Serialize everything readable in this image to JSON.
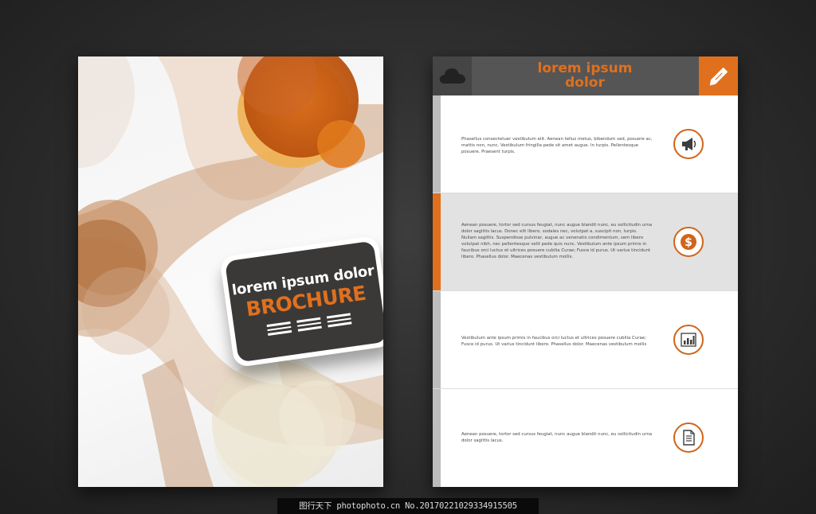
{
  "cover": {
    "badge_title": "lorem ipsum dolor",
    "badge_word": "BROCHURE"
  },
  "inner": {
    "header_title": "lorem ipsum dolor",
    "header_left_icon": "cloud-icon",
    "header_right_icon": "pencil-icon",
    "sections": [
      {
        "text": "Phasellus consectetuer vestibulum elit. Aenean tellus metus, bibendum sed, posuere ac, mattis non, nunc. Vestibulum fringilla pede sit amet augue. In turpis. Pellentesque posuere. Praesent turpis.",
        "icon": "megaphone-icon"
      },
      {
        "text": "Aenean posuere, tortor sed cursus feugiat, nunc augue blandit nunc, eu sollicitudin urna dolor sagittis lacus. Donec elit libero, sodales nec, volutpat a, suscipit non, turpis. Nullam sagittis. Suspendisse pulvinar, augue ac venenatis condimentum, sem libero volutpat nibh, nec pellentesque velit pede quis nunc. Vestibulum ante ipsum primis in faucibus orci luctus et ultrices posuere cubilia Curae; Fusce id purus. Ut varius tincidunt libero. Phasellus dolor. Maecenas vestibulum mollis.",
        "icon": "dollar-icon"
      },
      {
        "text": "Vestibulum ante ipsum primis in faucibus orci luctus et ultrices posuere cubilia Curae; Fusce id purus. Ut varius tincidunt libero. Phasellus dolor. Maecenas vestibulum mollis",
        "icon": "bar-chart-icon"
      },
      {
        "text": "Aenean posuere, tortor sed cursus feugiat, nunc augue blandit nunc, eu sollicitudin urna dolor sagittis lacus.",
        "icon": "document-icon"
      }
    ]
  },
  "colors": {
    "accent": "#e0701d",
    "dark": "#3b3938",
    "header": "#555556",
    "band": "#e2e2e2"
  },
  "watermark": "图行天下 photophoto.cn No.20170221029334915505"
}
